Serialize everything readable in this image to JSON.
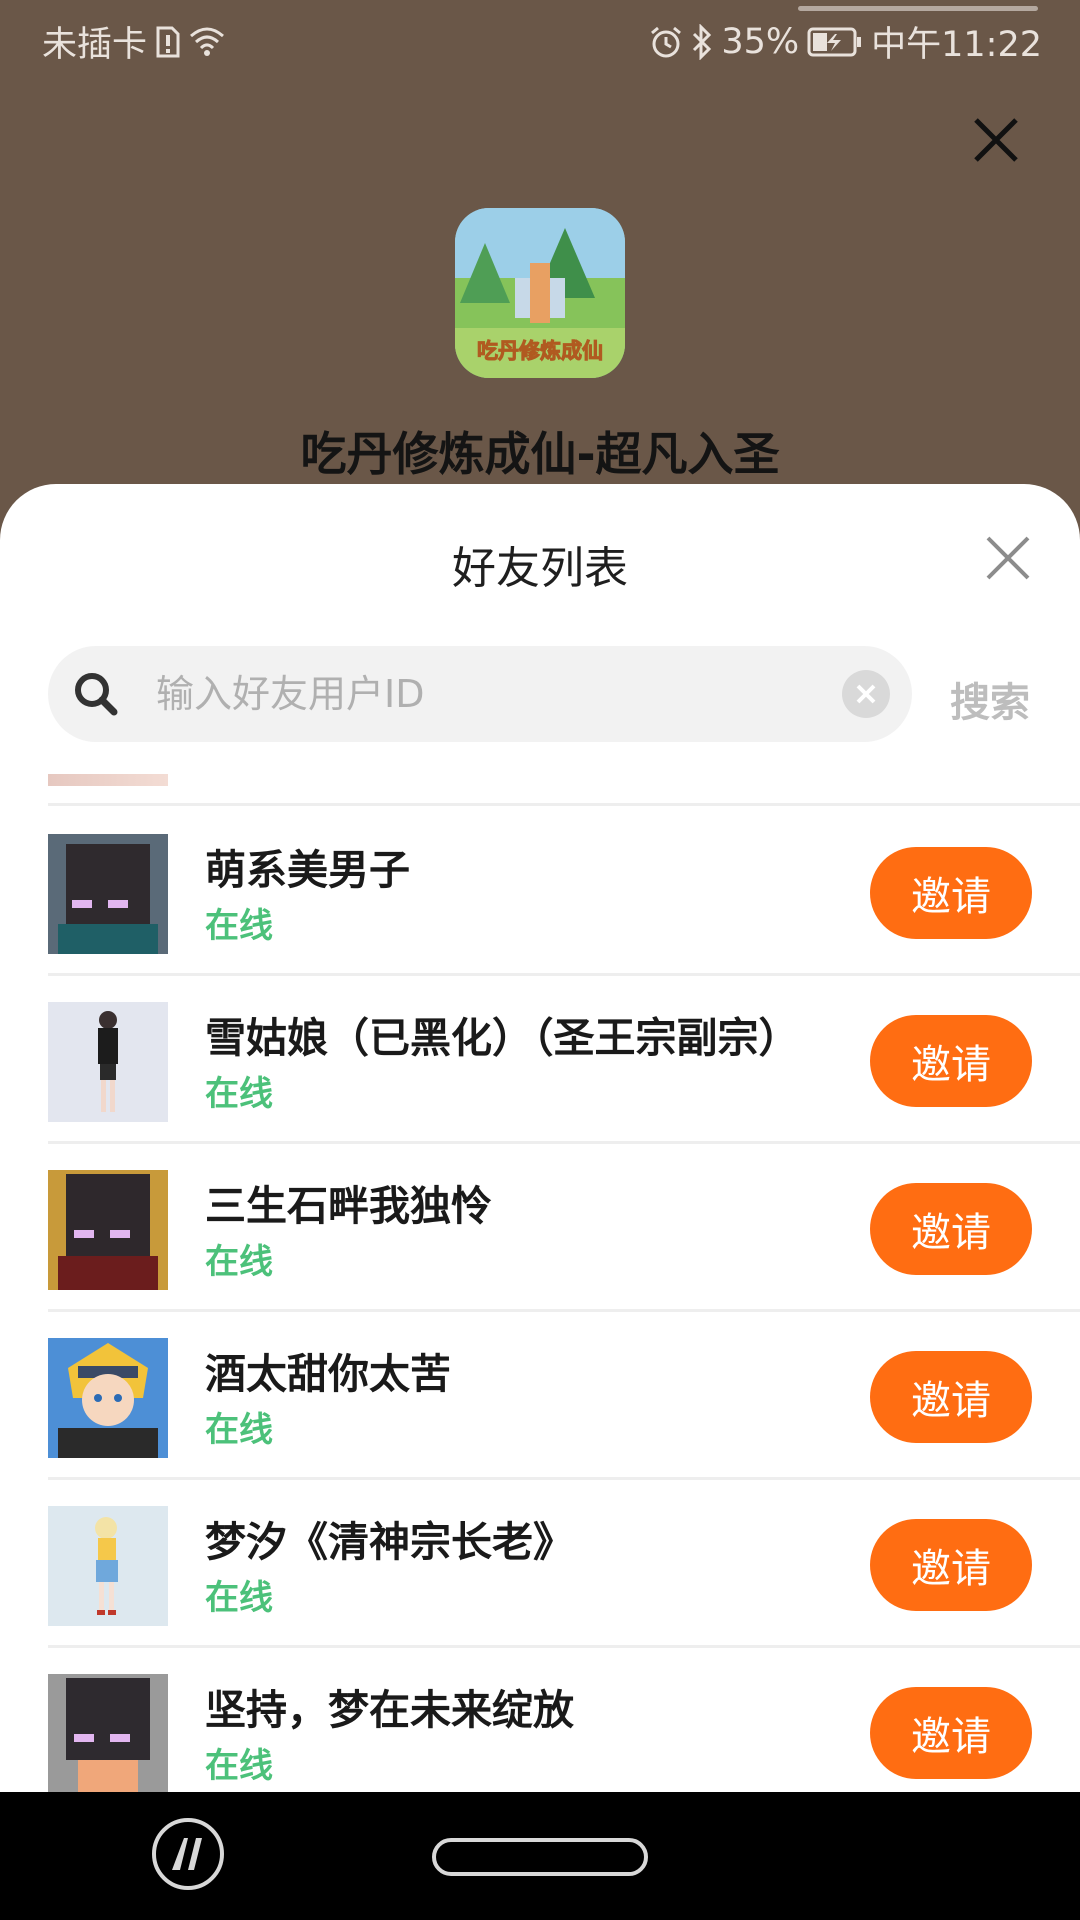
{
  "status_bar": {
    "carrier": "未插卡",
    "battery": "35%",
    "time": "中午11:22"
  },
  "game": {
    "icon_caption": "吃丹修炼成仙",
    "title": "吃丹修炼成仙-超凡入圣"
  },
  "sheet": {
    "title": "好友列表",
    "search_placeholder": "输入好友用户ID",
    "search_button": "搜索"
  },
  "friends": [
    {
      "name": "萌系美男子",
      "status": "在线",
      "invite": "邀请",
      "avatar": "enderman-avatar"
    },
    {
      "name": "雪姑娘（已黑化）（圣王宗副宗）",
      "status": "在线",
      "invite": "邀请",
      "avatar": "girl-avatar"
    },
    {
      "name": "三生石畔我独怜",
      "status": "在线",
      "invite": "邀请",
      "avatar": "enderman-avatar"
    },
    {
      "name": "酒太甜你太苦",
      "status": "在线",
      "invite": "邀请",
      "avatar": "anime-avatar"
    },
    {
      "name": "梦汐《清神宗长老》",
      "status": "在线",
      "invite": "邀请",
      "avatar": "girl-avatar"
    },
    {
      "name": "坚持，梦在未来绽放",
      "status": "在线",
      "invite": "邀请",
      "avatar": "enderman-avatar"
    }
  ],
  "colors": {
    "accent": "#ff6d12",
    "online": "#4cc17a",
    "backdrop": "#6a5748"
  }
}
